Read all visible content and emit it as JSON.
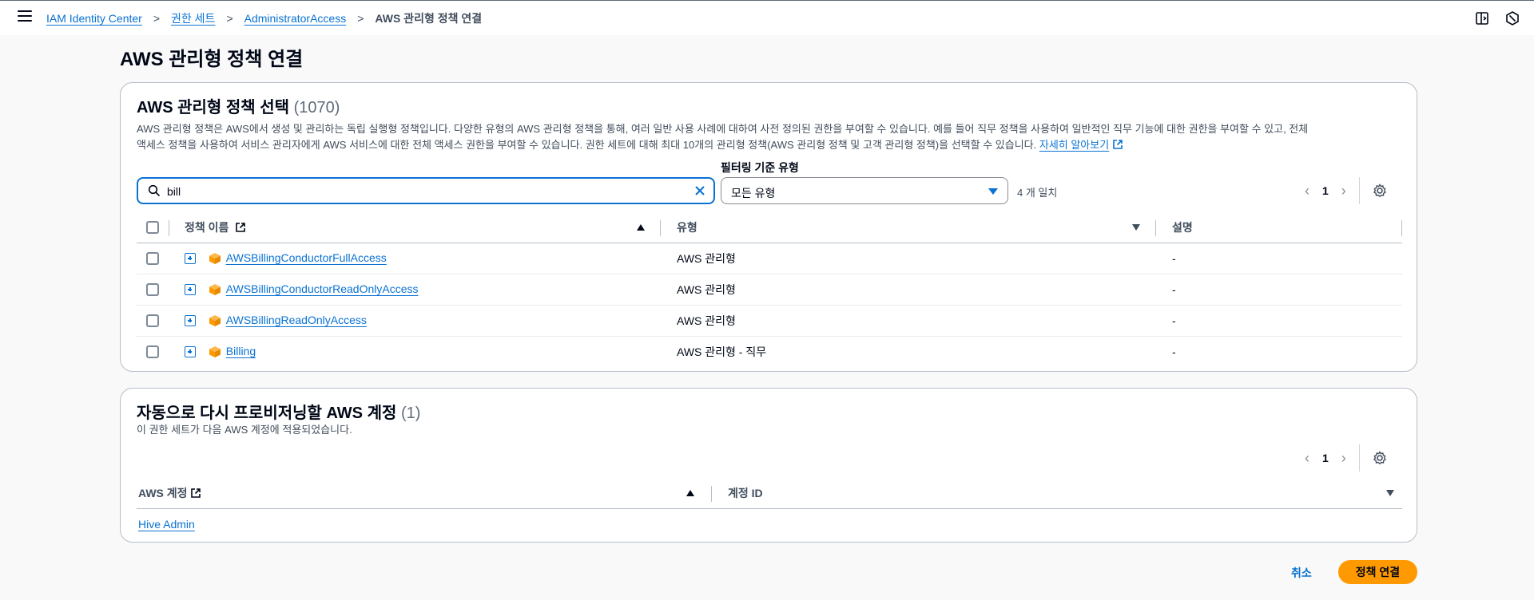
{
  "header": {
    "menu_icon": "hamburger-menu-icon",
    "breadcrumbs": [
      {
        "label": "IAM Identity Center"
      },
      {
        "label": "권한 세트"
      },
      {
        "label": "AdministratorAccess"
      },
      {
        "label": "AWS 관리형 정책 연결"
      }
    ],
    "right_icons": [
      "side-panel-icon",
      "notifications-icon"
    ]
  },
  "page_title": "AWS 관리형 정책 연결",
  "policy_panel": {
    "title": "AWS 관리형 정책 선택",
    "count": "(1070)",
    "description_1": "AWS 관리형 정책은 AWS에서 생성 및 관리하는 독립 실행형 정책입니다. 다양한 유형의 AWS 관리형 정책을 통해, 여러 일반 사용 사례에 대하여 사전 정의된 권한을 부여할 수 있습니다. 예를 들어 직무 정책을 사용하여 일반적인 직무 기능에 대한 권한을 부여할 수 있고, 전체",
    "description_2": "액세스 정책을 사용하여 서비스 관리자에게 AWS 서비스에 대한 전체 액세스 권한을 부여할 수 있습니다. 권한 세트에 대해 최대 10개의 관리형 정책(AWS 관리형 정책 및 고객 관리형 정책)을 선택할 수 있습니다.",
    "learn_more": "자세히 알아보기",
    "search_value": "bill",
    "filter_label": "필터링 기준 유형",
    "filter_value": "모든 유형",
    "match_count": "4 개 일치",
    "page": "1",
    "columns": {
      "name": "정책 이름",
      "type": "유형",
      "description": "설명"
    },
    "rows": [
      {
        "name": "AWSBillingConductorFullAccess",
        "type": "AWS 관리형",
        "description": "-"
      },
      {
        "name": "AWSBillingConductorReadOnlyAccess",
        "type": "AWS 관리형",
        "description": "-"
      },
      {
        "name": "AWSBillingReadOnlyAccess",
        "type": "AWS 관리형",
        "description": "-"
      },
      {
        "name": "Billing",
        "type": "AWS 관리형 - 직무",
        "description": "-"
      }
    ]
  },
  "accounts_panel": {
    "title": "자동으로 다시 프로비저닝할 AWS 계정",
    "count": "(1)",
    "description": "이 권한 세트가 다음 AWS 계정에 적용되었습니다.",
    "page": "1",
    "columns": {
      "account": "AWS 계정",
      "account_id": "계정 ID"
    },
    "rows": [
      {
        "account": "Hive Admin",
        "account_id": ""
      }
    ]
  },
  "actions": {
    "cancel": "취소",
    "submit": "정책 연결"
  },
  "colors": {
    "accent": "#0972d3",
    "primary_button": "#ff9900",
    "border": "#b6bec9"
  }
}
